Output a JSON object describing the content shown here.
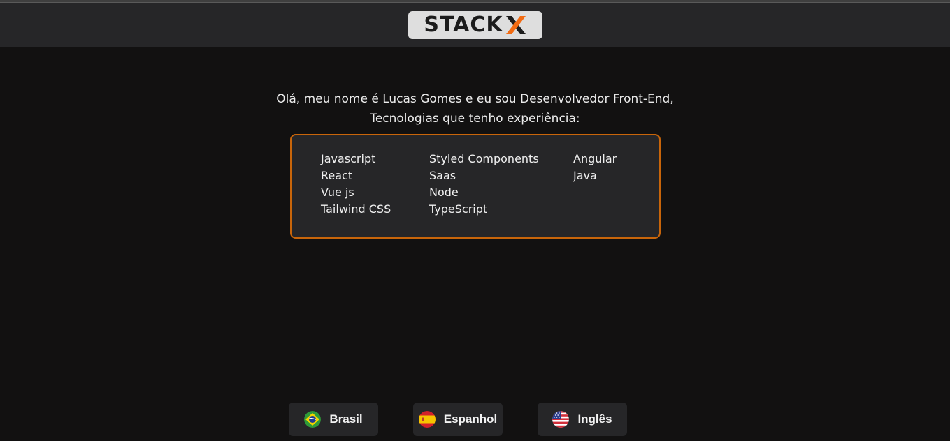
{
  "header": {
    "logo_text": "STACK",
    "logo_mark": "X",
    "logo_accent_color": "#f26b12"
  },
  "intro": {
    "line1": "Olá, meu nome é Lucas Gomes e eu sou Desenvolvedor Front-End,",
    "line2": "Tecnologias que tenho experiência:"
  },
  "technologies": {
    "columns": [
      [
        "Javascript",
        "React",
        "Vue js",
        "Tailwind CSS"
      ],
      [
        "Styled Components",
        "Saas",
        "Node",
        "TypeScript"
      ],
      [
        "Angular",
        "Java"
      ]
    ],
    "border_color": "#c8650a"
  },
  "languages": [
    {
      "label": "Brasil",
      "icon": "brazil-flag-icon"
    },
    {
      "label": "Espanhol",
      "icon": "spain-flag-icon"
    },
    {
      "label": "Inglês",
      "icon": "usa-flag-icon"
    }
  ]
}
